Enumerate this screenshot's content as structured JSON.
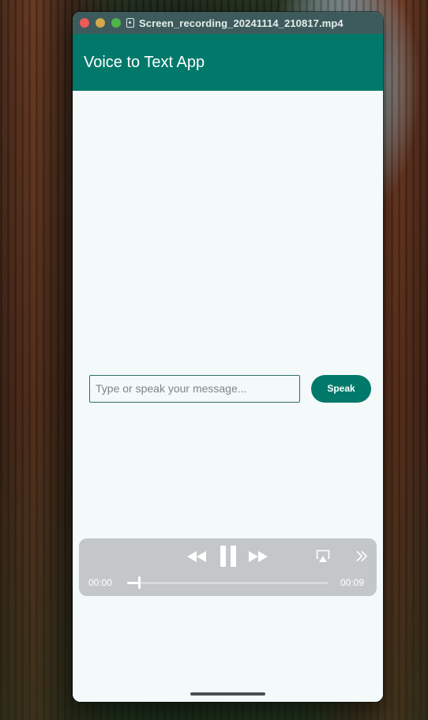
{
  "window": {
    "title": "Screen_recording_20241114_210817.mp4"
  },
  "app": {
    "title": "Voice to Text App"
  },
  "input": {
    "value": "",
    "placeholder": "Type or speak your message..."
  },
  "speak_button": {
    "label": "Speak"
  },
  "player": {
    "current_time": "00:00",
    "total_time": "00:09",
    "progress": 0.06
  },
  "colors": {
    "app_bar": "#00796b",
    "titlebar": "#3d5b5c",
    "background": "#f4f9fa"
  },
  "icons": [
    "file-icon",
    "rewind-icon",
    "pause-icon",
    "fast-forward-icon",
    "airplay-icon",
    "chevron-double-right-icon"
  ]
}
